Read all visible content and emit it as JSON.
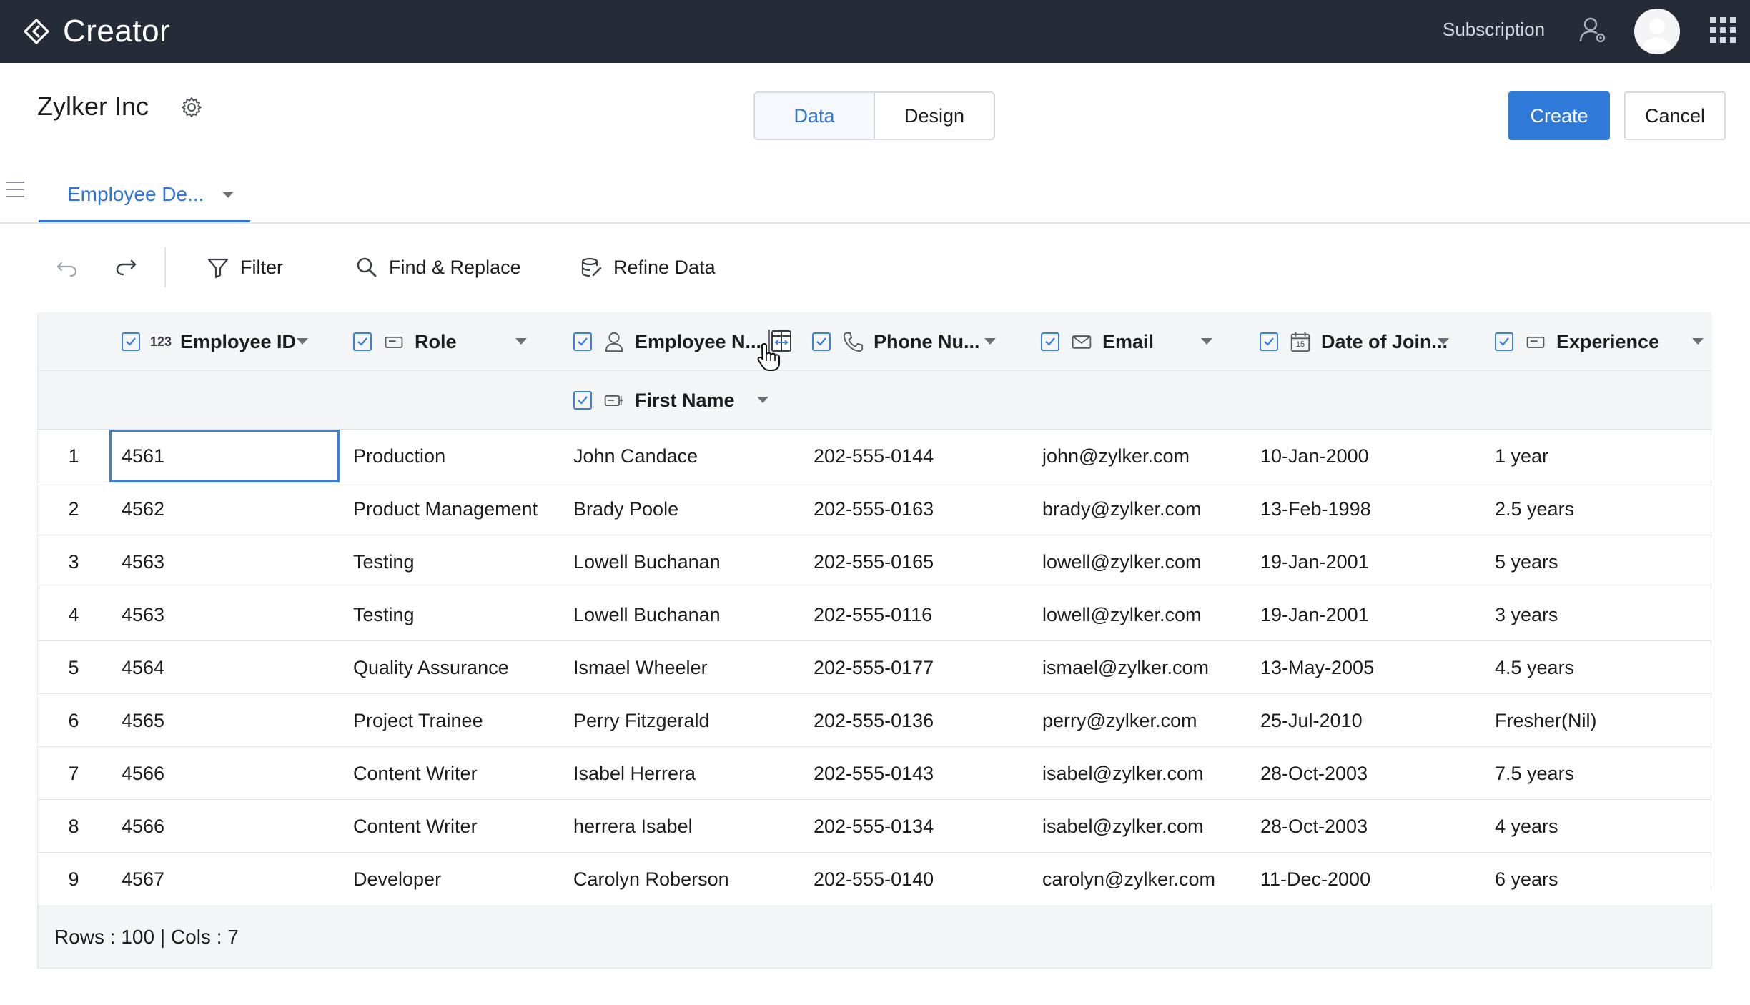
{
  "topbar": {
    "brand_name": "Creator",
    "subscription_label": "Subscription",
    "icons": [
      "creator-logo-icon",
      "user-settings-icon",
      "avatar",
      "apps-grid-icon"
    ]
  },
  "header": {
    "app_title": "Zylker Inc",
    "mode_tabs": [
      {
        "label": "Data",
        "active": true
      },
      {
        "label": "Design",
        "active": false
      }
    ],
    "create_label": "Create",
    "cancel_label": "Cancel"
  },
  "sheet_tab": {
    "label": "Employee De..."
  },
  "toolbar": {
    "filter_label": "Filter",
    "find_replace_label": "Find & Replace",
    "refine_label": "Refine Data"
  },
  "columns": [
    {
      "label": "Employee ID",
      "icon": "number-123-icon",
      "icon_text": "123"
    },
    {
      "label": "Role",
      "icon": "text-field-icon"
    },
    {
      "label": "Employee N...",
      "icon": "person-icon"
    },
    {
      "label": "Phone Nu...",
      "icon": "phone-icon"
    },
    {
      "label": "Email",
      "icon": "mail-icon"
    },
    {
      "label": "Date of Join...",
      "icon": "calendar-icon",
      "icon_text": "15"
    },
    {
      "label": "Experience",
      "icon": "text-field-icon"
    }
  ],
  "subcolumn": {
    "label": "First Name",
    "icon": "name-field-icon"
  },
  "rows": [
    {
      "n": "1",
      "id": "4561",
      "role": "Production",
      "name": "John Candace",
      "phone": "202-555-0144",
      "email": "john@zylker.com",
      "doj": "10-Jan-2000",
      "exp": "1 year"
    },
    {
      "n": "2",
      "id": "4562",
      "role": "Product Management",
      "name": "Brady Poole",
      "phone": "202-555-0163",
      "email": "brady@zylker.com",
      "doj": "13-Feb-1998",
      "exp": "2.5 years"
    },
    {
      "n": "3",
      "id": "4563",
      "role": "Testing",
      "name": "Lowell Buchanan",
      "phone": "202-555-0165",
      "email": "lowell@zylker.com",
      "doj": "19-Jan-2001",
      "exp": "5 years"
    },
    {
      "n": "4",
      "id": "4563",
      "role": "Testing",
      "name": "Lowell Buchanan",
      "phone": "202-555-0116",
      "email": "lowell@zylker.com",
      "doj": "19-Jan-2001",
      "exp": "3 years"
    },
    {
      "n": "5",
      "id": "4564",
      "role": "Quality Assurance",
      "name": "Ismael Wheeler",
      "phone": "202-555-0177",
      "email": "ismael@zylker.com",
      "doj": "13-May-2005",
      "exp": "4.5 years"
    },
    {
      "n": "6",
      "id": "4565",
      "role": "Project Trainee",
      "name": "Perry Fitzgerald",
      "phone": "202-555-0136",
      "email": "perry@zylker.com",
      "doj": "25-Jul-2010",
      "exp": "Fresher(Nil)"
    },
    {
      "n": "7",
      "id": "4566",
      "role": "Content Writer",
      "name": "Isabel Herrera",
      "phone": "202-555-0143",
      "email": "isabel@zylker.com",
      "doj": "28-Oct-2003",
      "exp": "7.5 years"
    },
    {
      "n": "8",
      "id": "4566",
      "role": "Content Writer",
      "name": "herrera Isabel",
      "phone": "202-555-0134",
      "email": "isabel@zylker.com",
      "doj": "28-Oct-2003",
      "exp": "4 years"
    },
    {
      "n": "9",
      "id": "4567",
      "role": "Developer",
      "name": "Carolyn Roberson",
      "phone": "202-555-0140",
      "email": "carolyn@zylker.com",
      "doj": "11-Dec-2000",
      "exp": "6 years"
    }
  ],
  "footer": {
    "summary": "Rows : 100 | Cols : 7"
  },
  "colors": {
    "topbar": "#262b38",
    "accent": "#2f73d5",
    "create_button": "#2f79d8",
    "header_bg": "#f4f5f7"
  }
}
